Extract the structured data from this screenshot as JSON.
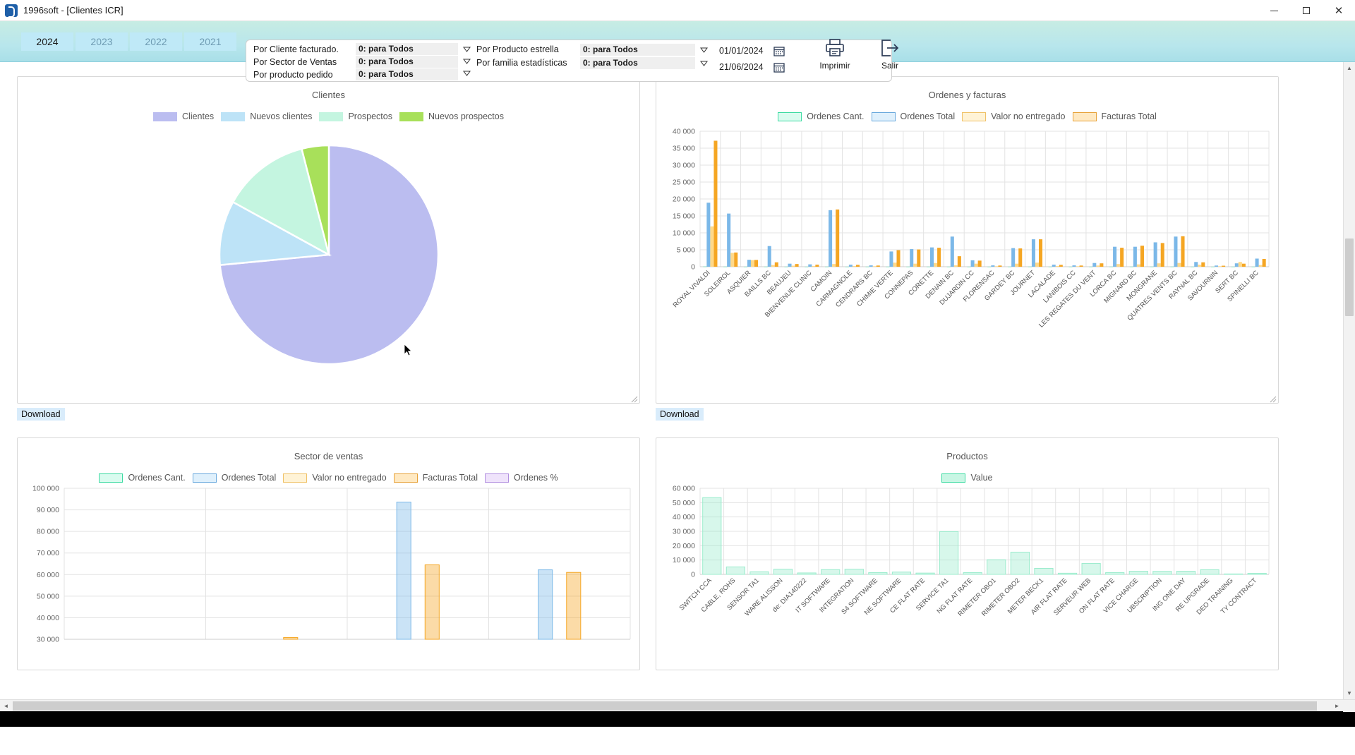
{
  "window": {
    "title": "1996soft - [Clientes ICR]",
    "app_icon": "app-logo-icon",
    "minimize": "–",
    "maximize": "□",
    "close": "✕"
  },
  "toolbar": {
    "years": [
      {
        "label": "2024",
        "active": true
      },
      {
        "label": "2023",
        "active": false
      },
      {
        "label": "2022",
        "active": false
      },
      {
        "label": "2021",
        "active": false
      }
    ],
    "filters_left": [
      {
        "label": "Por Cliente facturado.",
        "value": "0: para Todos"
      },
      {
        "label": "Por Sector de Ventas",
        "value": "0: para Todos"
      },
      {
        "label": "Por producto pedido",
        "value": "0: para Todos"
      }
    ],
    "filters_right": [
      {
        "label": "Por Producto estrella",
        "value": "0: para Todos"
      },
      {
        "label": "Por familia estadísticas",
        "value": "0: para Todos"
      }
    ],
    "dates": [
      {
        "value": "01/01/2024",
        "icon": "calendar-icon"
      },
      {
        "value": "21/06/2024",
        "icon": "calendar-icon"
      }
    ],
    "actions": [
      {
        "label": "Imprimir",
        "icon": "printer-icon"
      },
      {
        "label": "Salir",
        "icon": "exit-icon"
      }
    ]
  },
  "download_label": "Download",
  "colors": {
    "clientes": "#bbbdf0",
    "nuevos_clientes": "#bde3f7",
    "prospectos": "#c4f5e0",
    "nuevos_prospectos": "#a8e05a",
    "ordenes_cant": "#5fe3b0",
    "ordenes_total": "#7bb8e8",
    "valor_no_entregado": "#ffd98a",
    "facturas_total": "#f5a623",
    "ordenes_pct": "#c9a8f0",
    "toolbar_bg": "#b8e6ec",
    "year_btn": "#bfe9f7",
    "download_bg": "#d9ecfb"
  },
  "chart_data": [
    {
      "id": "clientes",
      "type": "pie",
      "title": "Clientes",
      "legend_position": "top",
      "categories": [
        "Clientes",
        "Nuevos clientes",
        "Prospectos",
        "Nuevos prospectos"
      ],
      "values": [
        73.5,
        9.5,
        13.0,
        4.0
      ],
      "colors": [
        "#bbbdf0",
        "#bde3f7",
        "#c4f5e0",
        "#a8e05a"
      ]
    },
    {
      "id": "ordenes-y-facturas",
      "type": "bar",
      "title": "Ordenes y facturas",
      "legend_position": "top",
      "xlabel": "",
      "ylabel": "",
      "ylim": [
        0,
        40000
      ],
      "yticks": [
        0,
        5000,
        10000,
        15000,
        20000,
        25000,
        30000,
        35000,
        40000
      ],
      "ytick_labels": [
        "0",
        "5 000",
        "10 000",
        "15 000",
        "20 000",
        "25 000",
        "30 000",
        "35 000",
        "40 000"
      ],
      "grid": true,
      "categories": [
        "ROYAL VIVALDI",
        "SOLEIROL",
        "ASQUIER",
        "BAILLS BC",
        "BEAUJEU",
        "BIENVENUE CLINIC",
        "CAMOIN",
        "CARMAGNOLE",
        "CENDRARS BC",
        "CHIMIE VERTE",
        "CONNEPAS",
        "CORETTE",
        "DENAIN BC",
        "DUJARDIN CC",
        "FLORENSAC",
        "GARDEY BC",
        "JOURNET",
        "LACALADE",
        "LANIBOIS CC",
        "LES REGATES DU VENT",
        "LORCA BC",
        "MIGNARD BC",
        "MONGRANE",
        "QUATRES VENTS BC",
        "RAYNAL BC",
        "SAVOURNIN",
        "SERT BC",
        "SPINELLI BC"
      ],
      "series": [
        {
          "name": "Ordenes Cant.",
          "color": "#5fe3b0",
          "values": [
            60,
            30,
            10,
            20,
            15,
            15,
            25,
            15,
            20,
            20,
            20,
            25,
            15,
            10,
            10,
            20,
            25,
            10,
            10,
            15,
            20,
            20,
            25,
            25,
            15,
            10,
            15,
            15
          ]
        },
        {
          "name": "Ordenes Total",
          "color": "#7bb8e8",
          "values": [
            18900,
            15700,
            2050,
            6100,
            900,
            700,
            16700,
            600,
            400,
            4500,
            5200,
            5700,
            8900,
            1900,
            400,
            5500,
            8100,
            600,
            400,
            1100,
            5900,
            5900,
            7200,
            8900,
            1400,
            350,
            1000,
            2400
          ]
        },
        {
          "name": "Valor no entregado",
          "color": "#ffd98a",
          "values": [
            11900,
            4100,
            1950,
            500,
            300,
            200,
            800,
            200,
            150,
            1200,
            900,
            1100,
            400,
            900,
            150,
            900,
            1200,
            200,
            150,
            350,
            800,
            700,
            1000,
            1100,
            600,
            150,
            1400,
            500
          ]
        },
        {
          "name": "Facturas Total",
          "color": "#f5a623",
          "values": [
            37200,
            4200,
            2000,
            1300,
            800,
            600,
            16900,
            550,
            350,
            4900,
            5100,
            5600,
            3100,
            1800,
            350,
            5400,
            8100,
            550,
            350,
            1000,
            5600,
            6200,
            7000,
            9000,
            1300,
            300,
            900,
            2300
          ]
        }
      ]
    },
    {
      "id": "sector-de-ventas",
      "type": "bar",
      "title": "Sector de ventas",
      "legend_position": "top",
      "xlabel": "",
      "ylabel": "",
      "ylim": [
        30000,
        100000
      ],
      "yticks": [
        30000,
        40000,
        50000,
        60000,
        70000,
        80000,
        90000,
        100000
      ],
      "ytick_labels": [
        "30 000",
        "40 000",
        "50 000",
        "60 000",
        "70 000",
        "80 000",
        "90 000",
        "100 000"
      ],
      "grid": true,
      "categories": [
        "",
        "",
        "",
        ""
      ],
      "series": [
        {
          "name": "Ordenes Cant.",
          "color": "#5fe3b0",
          "values": [
            0,
            0,
            0,
            0
          ]
        },
        {
          "name": "Ordenes Total",
          "color": "#7bb8e8",
          "values": [
            0,
            0,
            93600,
            62200
          ]
        },
        {
          "name": "Valor no entregado",
          "color": "#ffd98a",
          "values": [
            0,
            0,
            0,
            0
          ]
        },
        {
          "name": "Facturas Total",
          "color": "#f5a623",
          "values": [
            0,
            30800,
            64500,
            61000
          ]
        },
        {
          "name": "Ordenes %",
          "color": "#c9a8f0",
          "values": [
            0,
            0,
            0,
            0
          ]
        }
      ]
    },
    {
      "id": "productos",
      "type": "bar",
      "title": "Productos",
      "legend_position": "top",
      "xlabel": "",
      "ylabel": "",
      "ylim": [
        0,
        60000
      ],
      "yticks": [
        0,
        10000,
        20000,
        30000,
        40000,
        50000,
        60000
      ],
      "ytick_labels": [
        "0",
        "10 000",
        "20 000",
        "30 000",
        "40 000",
        "50 000",
        "60 000"
      ],
      "grid": true,
      "categories": [
        "SWITCH CCA",
        "CABLE, ROHS",
        "SENSOR TA1",
        "WARE ALISSON",
        "de: DIA140222",
        "IT SOFTWARE",
        "INTEGRATION",
        "S4 SOFTWARE",
        "NE SOFTWARE",
        "CE FLAT RATE",
        "SERVICE TA1",
        "NG FLAT RATE",
        "RIMETER OBO1",
        "RIMETER OBO2",
        "METER BECK1",
        "AIR FLAT RATE",
        "SERVEUR WEB",
        "ON FLAT RATE",
        "VICE CHARGE",
        "UBSCRIPTION",
        "ING ONE DAY",
        "RE UPGRADE",
        "DEO TRAINING",
        "TY CONTRACT"
      ],
      "series": [
        {
          "name": "Value",
          "color": "#9beccd",
          "values": [
            53500,
            5200,
            1800,
            3600,
            1000,
            3300,
            3600,
            1200,
            1600,
            900,
            29800,
            1200,
            10200,
            15500,
            4200,
            800,
            7600,
            1200,
            2200,
            2100,
            2200,
            3200,
            300,
            700
          ]
        }
      ]
    }
  ],
  "scrollbars": {
    "up_arrow": "▲",
    "down_arrow": "▼",
    "left_arrow": "◄",
    "right_arrow": "►"
  }
}
